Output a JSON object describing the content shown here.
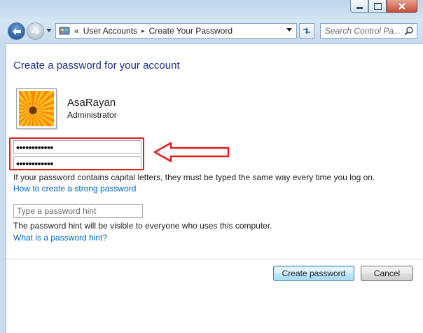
{
  "window": {
    "caption_buttons": [
      "minimize",
      "maximize",
      "close"
    ]
  },
  "navigation": {
    "breadcrumb": {
      "overflow": "«",
      "items": [
        "User Accounts",
        "Create Your Password"
      ],
      "separator": "▸"
    },
    "search_placeholder": "Search Control Pa..."
  },
  "main": {
    "title": "Create a password for your account",
    "user": {
      "name": "AsaRayan",
      "role": "Administrator"
    },
    "new_password": "••••••••••••",
    "confirm_password": "••••••••••••",
    "caps_note": "If your password contains capital letters, they must be typed the same way every time you log on.",
    "strong_password_link": "How to create a strong password",
    "hint_placeholder": "Type a password hint",
    "hint_note": "The password hint will be visible to everyone who uses this computer.",
    "hint_help_link": "What is a password hint?"
  },
  "buttons": {
    "create": "Create password",
    "cancel": "Cancel"
  },
  "annotation": {
    "highlight_color": "#e51d1d"
  },
  "colors": {
    "title": "#1e3287",
    "link": "#0066cc"
  }
}
